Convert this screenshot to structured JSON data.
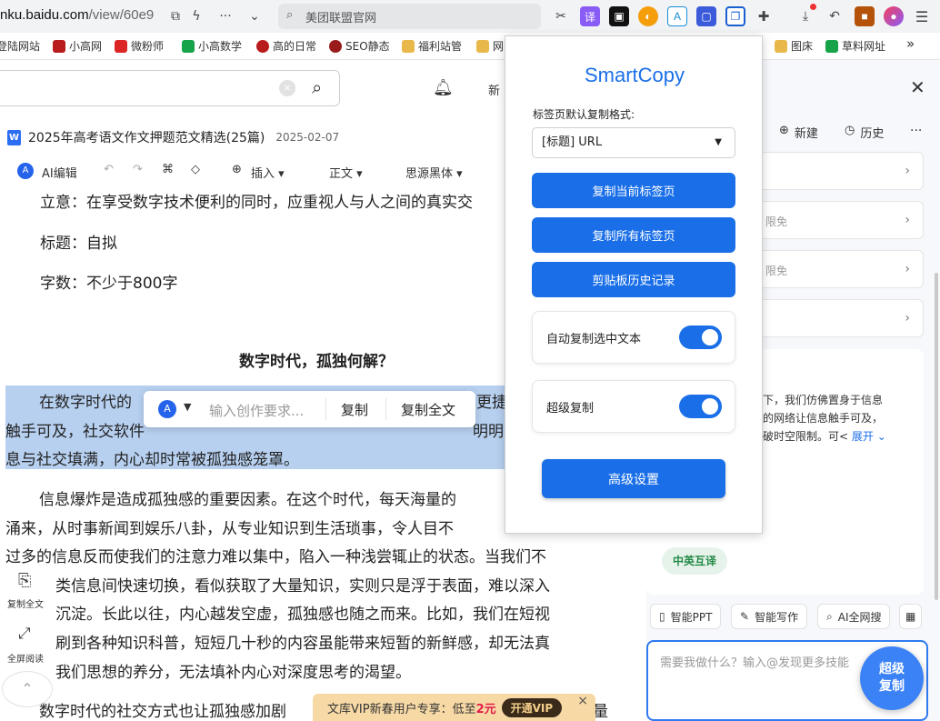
{
  "browser": {
    "url_domain": "nku.baidu.com",
    "url_path": "/view/60e9",
    "search_text": "美团联盟官网",
    "ext_translate": "译",
    "ext_a": "A"
  },
  "bookmarks": [
    "登陆网站",
    "小高网",
    "微粉师",
    "小高数学",
    "高的日常",
    "SEO静态",
    "福利站管",
    "网",
    "图床",
    "草料网址"
  ],
  "bookmark_more": "»",
  "doc": {
    "title": "2025年高考语文作文押题范文精选(25篇)",
    "date": "2025-02-07",
    "notify_label": "新",
    "toolbar": {
      "ai_edit": "AI编辑",
      "insert": "插入",
      "style": "正文",
      "font": "思源黑体"
    },
    "lines": {
      "meaning": "立意：在享受数字技术便利的同时，应重视人与人之间的真实交",
      "title_line": "标题：自拟",
      "wordcount": "字数：不少于800字",
      "heading": "数字时代，孤独何解？",
      "p1_l1": "在数字时代的",
      "p1_l1b": "更捷",
      "p1_l2": "触手可及，社交软件",
      "p1_l2b": "明明",
      "p1_l3": "息与社交填满，内心却时常被孤独感笼罩。",
      "p2_l1": "信息爆炸是造成孤独感的重要因素。在这个时代，每天海量的",
      "p2_l2": "涌来，从时事新闻到娱乐八卦，从专业知识到生活琐事，令人目不",
      "p2_l3": "过多的信息反而使我们的注意力难以集中，陷入一种浅尝辄止的状态。当我们不",
      "p2_l4": "类信息间快速切换，看似获取了大量知识，实则只是浮于表面，难以深入",
      "p2_l5": "沉淀。长此以往，内心越发空虚，孤独感也随之而来。比如，我们在短视",
      "p2_l6": "刷到各种知识科普，短短几十秒的内容虽能带来短暂的新鲜感，却无法真",
      "p2_l7": "我们思想的养分，无法填补内心对深度思考的渴望。",
      "p3_l1": "数字时代的社交方式也让孤独感加剧",
      "p3_l1b": "量"
    }
  },
  "float_toolbar": {
    "placeholder": "输入创作要求...",
    "copy": "复制",
    "copy_all": "复制全文"
  },
  "left_tools": {
    "copy_all": "复制全文",
    "fullscreen": "全屏阅读"
  },
  "vip": {
    "text": "文库VIP新春用户专享：低至",
    "price": "2元",
    "button": "开通VIP",
    "close": "×"
  },
  "popup": {
    "title": "SmartCopy",
    "format_label": "标签页默认复制格式:",
    "format_value": "[标题] URL",
    "btn_copy_current": "复制当前标签页",
    "btn_copy_all": "复制所有标签页",
    "btn_history": "剪贴板历史记录",
    "auto_copy_label": "自动复制选中文本",
    "auto_copy_on": true,
    "super_copy_label": "超级复制",
    "super_copy_on": true,
    "advanced": "高级设置",
    "accent": "#1a6fe8"
  },
  "rpanel": {
    "new": "新建",
    "history": "历史",
    "more": "···",
    "free1": "限免",
    "free2": "限免",
    "snippet_l1": "下，我们仿佛置身于信息",
    "snippet_l2": "的网络让信息触手可及，",
    "snippet_l3": "破时空限制。可<",
    "expand": "展开",
    "translate": "中英互译",
    "chip_ppt": "智能PPT",
    "chip_write": "智能写作",
    "chip_search": "AI全网搜",
    "input_placeholder": "需要我做什么？输入@发现更多技能",
    "super_copy_fab_l1": "超级",
    "super_copy_fab_l2": "复制"
  }
}
